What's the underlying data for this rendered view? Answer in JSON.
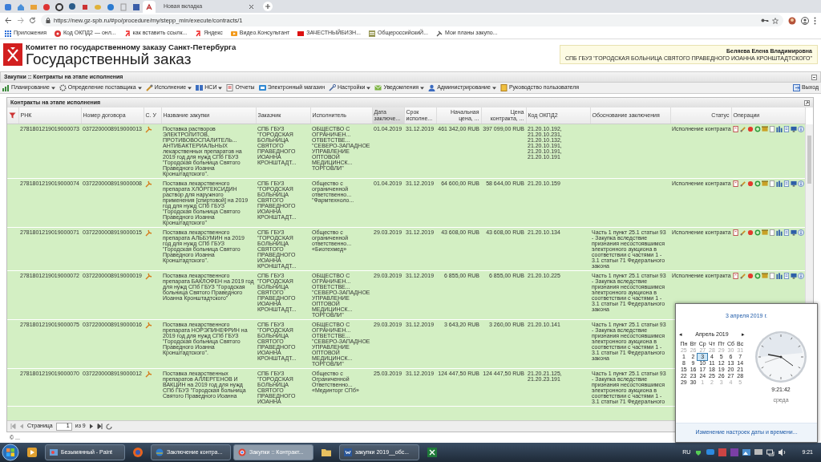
{
  "browser": {
    "tabs": [
      {
        "kind": "favicon",
        "selected": false
      },
      {
        "kind": "favicon",
        "selected": false
      },
      {
        "kind": "favicon",
        "selected": false
      },
      {
        "kind": "favicon",
        "selected": false
      },
      {
        "kind": "favicon",
        "selected": false
      },
      {
        "kind": "favicon",
        "selected": false
      },
      {
        "kind": "favicon",
        "selected": false
      },
      {
        "kind": "favicon",
        "selected": false
      },
      {
        "kind": "favicon",
        "selected": false
      },
      {
        "kind": "favicon",
        "selected": false
      },
      {
        "kind": "favicon",
        "selected": false
      },
      {
        "kind": "favicon",
        "selected": true
      },
      {
        "kind": "titled",
        "title": "Новая вкладка",
        "selected": false
      }
    ],
    "url": "https://new.gz-spb.ru/#po/procedure/my/stepp_min/execute/contracts/1",
    "bookmarks": [
      "Приложения",
      "Код ОКПД2 — онл...",
      "как вставить ссылк...",
      "Яндекс",
      "Видео.Консультант",
      "ЗАЧЕСТНЫЙБИЗН...",
      "ОбщероссийскиЙ...",
      "Мои планы закупо..."
    ]
  },
  "site_header": {
    "org": "Комитет по государственному заказу Санкт-Петербурга",
    "title": "Государственный заказ",
    "user_name": "Беляева Елена Владимировна",
    "user_org": "СПБ ГБУЗ \"ГОРОДСКАЯ БОЛЬНИЦА СВЯТОГО ПРАВЕДНОГО ИОАННА КРОНШТАДТСКОГО\""
  },
  "panel_title": "Закупки :: Контракты на этапе исполнения",
  "menu": [
    {
      "label": "Планирование",
      "has_menu": true
    },
    {
      "label": "Определение поставщика",
      "has_menu": true
    },
    {
      "label": "Исполнение",
      "has_menu": true
    },
    {
      "label": "НСИ",
      "has_menu": true
    },
    {
      "label": "Отчеты",
      "has_menu": false
    },
    {
      "label": "Электронный магазин",
      "has_menu": false
    },
    {
      "label": "Настройки",
      "has_menu": true
    },
    {
      "label": "Уведомления",
      "has_menu": true
    },
    {
      "label": "Администрирование",
      "has_menu": true
    },
    {
      "label": "Руководство пользователя",
      "has_menu": false
    }
  ],
  "exit": "Выход",
  "grid": {
    "title": "Контракты на этапе исполнения",
    "columns": [
      {
        "label": "РНК",
        "sorted": false
      },
      {
        "label": "Номер договора",
        "sorted": false
      },
      {
        "label": "С. У",
        "sorted": false
      },
      {
        "label": "Название закупки",
        "sorted": false
      },
      {
        "label": "Заказчик",
        "sorted": false
      },
      {
        "label": "Исполнитель",
        "sorted": false
      },
      {
        "label": "Дата заключе...",
        "sorted": true
      },
      {
        "label": "Срок исполне...",
        "sorted": false
      },
      {
        "label": "Начальная цена, ...",
        "sorted": false
      },
      {
        "label": "Цена контракта, ...",
        "sorted": false
      },
      {
        "label": "Код ОКПД2",
        "sorted": false
      },
      {
        "label": "Обоснование заключения",
        "sorted": false
      },
      {
        "label": "Статус",
        "sorted": false
      },
      {
        "label": "Операции",
        "sorted": false
      }
    ],
    "rows": [
      {
        "rnk": "2781801219019000073",
        "number": "0372200008919000013",
        "title": "Поставка растворов ЭЛЕКТРОЛИТОВ, ПРОТИВОВОСПАЛИТЕЛЬ... АНТИБАКТЕРИАЛЬНЫХ лекарственных препаратов на 2019 год для нужд СПб ГБУЗ \"Городская больница Святого Праведного Иоанна Кронштадтского\".",
        "customer": "СПБ ГБУЗ \"ГОРОДСКАЯ БОЛЬНИЦА СВЯТОГО ПРАВЕДНОГО ИОАННА КРОНШТАДТ...",
        "contractor": "ОБЩЕСТВО С ОГРАНИЧЕН... ОТВЕТСТВЕ... \"СЕВЕРО-ЗАПАДНОЕ УПРАВЛЕНИЕ ОПТОВОЙ МЕДИЦИНСК... ТОРГОВЛИ\"",
        "date": "01.04.2019",
        "term": "31.12.2019",
        "initial_price": "461 342,00 RUB",
        "price": "397 099,00 RUB",
        "okpd": "21.20.10.192, 21.20.10.231, 21.20.10.132, 21.20.10.191, 21.20.10.191, 21.20.10.191",
        "status": "Исполнение контракта"
      },
      {
        "rnk": "2781801219019000074",
        "number": "0372200008919000008",
        "title": "Поставка лекарственного препарата ХЛОРГЕКСИДИН раствор для наружного применения [спиртовой] на 2019 год для нужд СПб ГБУЗ \"Городская больница Святого Праведного Иоанна Кронштадтского\"",
        "customer": "СПБ ГБУЗ \"ГОРОДСКАЯ БОЛЬНИЦА СВЯТОГО ПРАВЕДНОГО ИОАННА КРОНШТАДТ...",
        "contractor": "Общество с ограниченной ответственно... \"Фармтехноло...",
        "date": "01.04.2019",
        "term": "31.12.2019",
        "initial_price": "64 600,00 RUB",
        "price": "58 644,00 RUB",
        "okpd": "21.20.10.159",
        "status": "Исполнение контракта"
      },
      {
        "rnk": "2781801219019000071",
        "number": "0372200008919000015",
        "title": "Поставка лекарственного препарата АЛЬБУМИН на 2019 год для нужд СПб ГБУЗ \"Городская больница Святого Праведного Иоанна Кронштадтского\".",
        "customer": "СПБ ГБУЗ \"ГОРОДСКАЯ БОЛЬНИЦА СВЯТОГО ПРАВЕДНОГО ИОАННА КРОНШТАДТ...",
        "contractor": "Общество с ограниченной ответственно... «Биотехмед»",
        "date": "29.03.2019",
        "term": "31.12.2019",
        "initial_price": "43 608,00 RUB",
        "price": "43 608,00 RUB",
        "okpd": "21.20.10.134",
        "basis": "Часть 1 пункт 25.1 статьи 93 - Закупка вследствие признания несостоявшимся электронного аукциона в соответствии с частями 1 - 3.1 статьи 71 Федерального закона",
        "status": "Исполнение контракта"
      },
      {
        "rnk": "2781801219019000072",
        "number": "0372200008919000019",
        "title": "Поставка лекарственного препарата БАКЛОФЕН на 2019 год для нужд СПб ГБУЗ \"Городская больница Святого Праведного Иоанна Кронштадтского\"",
        "customer": "СПБ ГБУЗ \"ГОРОДСКАЯ БОЛЬНИЦА СВЯТОГО ПРАВЕДНОГО ИОАННА КРОНШТАДТ...",
        "contractor": "ОБЩЕСТВО С ОГРАНИЧЕН... ОТВЕТСТВЕ... \"СЕВЕРО-ЗАПАДНОЕ УПРАВЛЕНИЕ ОПТОВОЙ МЕДИЦИНСК... ТОРГОВЛИ\"",
        "date": "29.03.2019",
        "term": "31.12.2019",
        "initial_price": "6 855,00 RUB",
        "price": "6 855,00 RUB",
        "okpd": "21.20.10.225",
        "basis": "Часть 1 пункт 25.1 статьи 93 - Закупка вследствие признания несостоявшимся электронного аукциона в соответствии с частями 1 - 3.1 статьи 71 Федерального закона",
        "status": "Исполнение контракта"
      },
      {
        "rnk": "2781801219019000075",
        "number": "0372200008919000016",
        "title": "Поставка лекарственного препарата НОРЭПИНЕФРИН на 2019 год для нужд СПб ГБУЗ \"Городская больница Святого Праведного Иоанна Кронштадтского\".",
        "customer": "СПБ ГБУЗ \"ГОРОДСКАЯ БОЛЬНИЦА СВЯТОГО ПРАВЕДНОГО ИОАННА КРОНШТАДТ...",
        "contractor": "ОБЩЕСТВО С ОГРАНИЧЕН... ОТВЕТСТВЕ... \"СЕВЕРО-ЗАПАДНОЕ УПРАВЛЕНИЕ ОПТОВОЙ МЕДИЦИНСК... ТОРГОВЛИ\"",
        "date": "29.03.2019",
        "term": "31.12.2019",
        "initial_price": "3 643,20 RUB",
        "price": "3 260,00 RUB",
        "okpd": "21.20.10.141",
        "basis": "Часть 1 пункт 25.1 статьи 93 - Закупка вследствие признания несостоявшимся электронного аукциона в соответствии с частями 1 - 3.1 статьи 71 Федерального закона"
      },
      {
        "rnk": "2781801219019000070",
        "number": "0372200008919000012",
        "title": "Поставка лекарственных препаратов АЛЛЕРГЕНОВ И ВАКЦИН на 2019 год для нужд СПб ГБУЗ \"Городская больница Святого Праведного Иоанна",
        "customer": "СПБ ГБУЗ \"ГОРОДСКАЯ БОЛЬНИЦА СВЯТОГО ПРАВЕДНОГО ИОАННА",
        "contractor": "Общество с Ограниченной Ответственно... «Мединторг СПб»",
        "date": "25.03.2019",
        "term": "31.12.2019",
        "initial_price": "124 447,50 RUB",
        "price": "124 447,50 RUB",
        "okpd": "21.20.21.125, 21.20.23.191",
        "basis": "Часть 1 пункт 25.1 статьи 93 - Закупка вследствие признания несостоявшимся электронного аукциона в соответствии с частями 1 - 3.1 статьи 71 Федерального"
      }
    ],
    "pager": {
      "page_label": "Страница",
      "page": "1",
      "of": "из 9"
    }
  },
  "footer": "© ...",
  "taskbar": [
    {
      "kind": "launcher"
    },
    {
      "kind": "window",
      "label": "Безымянный - Paint",
      "selected": false
    },
    {
      "kind": "launcher"
    },
    {
      "kind": "window",
      "label": "Заключение контра...",
      "selected": false
    },
    {
      "kind": "window",
      "label": "Закупки :: Контракт...",
      "selected": true
    },
    {
      "kind": "launcher"
    },
    {
      "kind": "window",
      "label": "закупки 2019__обс...",
      "selected": false
    },
    {
      "kind": "launcher"
    }
  ],
  "tray": {
    "lang": "RU",
    "time": "9:21"
  },
  "calendar": {
    "date_link": "3 апреля 2019 г.",
    "prev": "◂",
    "month": "Апрель 2019",
    "next": "▸",
    "weekdays": [
      "Пн",
      "Вт",
      "Ср",
      "Чт",
      "Пт",
      "Сб",
      "Вс"
    ],
    "weeks": [
      [
        {
          "d": "25",
          "other_month": true,
          "selected": false
        },
        {
          "d": "26",
          "other_month": true,
          "selected": false
        },
        {
          "d": "27",
          "other_month": true,
          "selected": false
        },
        {
          "d": "28",
          "other_month": true,
          "selected": false
        },
        {
          "d": "29",
          "other_month": true,
          "selected": false
        },
        {
          "d": "30",
          "other_month": true,
          "selected": false
        },
        {
          "d": "31",
          "other_month": true,
          "selected": false
        }
      ],
      [
        {
          "d": "1",
          "other_month": false,
          "selected": false
        },
        {
          "d": "2",
          "other_month": false,
          "selected": false
        },
        {
          "d": "3",
          "other_month": false,
          "selected": true
        },
        {
          "d": "4",
          "other_month": false,
          "selected": false
        },
        {
          "d": "5",
          "other_month": false,
          "selected": false
        },
        {
          "d": "6",
          "other_month": false,
          "selected": false
        },
        {
          "d": "7",
          "other_month": false,
          "selected": false
        }
      ],
      [
        {
          "d": "8",
          "other_month": false,
          "selected": false
        },
        {
          "d": "9",
          "other_month": false,
          "selected": false
        },
        {
          "d": "10",
          "other_month": false,
          "selected": false
        },
        {
          "d": "11",
          "other_month": false,
          "selected": false
        },
        {
          "d": "12",
          "other_month": false,
          "selected": false
        },
        {
          "d": "13",
          "other_month": false,
          "selected": false
        },
        {
          "d": "14",
          "other_month": false,
          "selected": false
        }
      ],
      [
        {
          "d": "15",
          "other_month": false,
          "selected": false
        },
        {
          "d": "16",
          "other_month": false,
          "selected": false
        },
        {
          "d": "17",
          "other_month": false,
          "selected": false
        },
        {
          "d": "18",
          "other_month": false,
          "selected": false
        },
        {
          "d": "19",
          "other_month": false,
          "selected": false
        },
        {
          "d": "20",
          "other_month": false,
          "selected": false
        },
        {
          "d": "21",
          "other_month": false,
          "selected": false
        }
      ],
      [
        {
          "d": "22",
          "other_month": false,
          "selected": false
        },
        {
          "d": "23",
          "other_month": false,
          "selected": false
        },
        {
          "d": "24",
          "other_month": false,
          "selected": false
        },
        {
          "d": "25",
          "other_month": false,
          "selected": false
        },
        {
          "d": "26",
          "other_month": false,
          "selected": false
        },
        {
          "d": "27",
          "other_month": false,
          "selected": false
        },
        {
          "d": "28",
          "other_month": false,
          "selected": false
        }
      ],
      [
        {
          "d": "29",
          "other_month": false,
          "selected": false
        },
        {
          "d": "30",
          "other_month": false,
          "selected": false
        },
        {
          "d": "1",
          "other_month": true,
          "selected": false
        },
        {
          "d": "2",
          "other_month": true,
          "selected": false
        },
        {
          "d": "3",
          "other_month": true,
          "selected": false
        },
        {
          "d": "4",
          "other_month": true,
          "selected": false
        },
        {
          "d": "5",
          "other_month": true,
          "selected": false
        }
      ]
    ],
    "time": "9:21:42",
    "weekday": "среда",
    "settings_link": "Изменение настроек даты и времени..."
  }
}
